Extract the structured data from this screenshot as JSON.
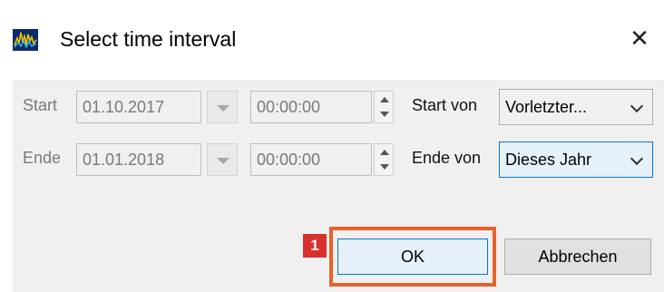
{
  "window": {
    "title": "Select time interval",
    "close_glyph": "✕",
    "app_icon": "waveform-app-icon"
  },
  "start_row": {
    "label": "Start",
    "date": "01.10.2017",
    "time": "00:00:00",
    "from_label": "Start von",
    "from_value": "Vorletzter..."
  },
  "end_row": {
    "label": "Ende",
    "date": "01.01.2018",
    "time": "00:00:00",
    "from_label": "Ende von",
    "from_value": "Dieses Jahr"
  },
  "buttons": {
    "ok": "OK",
    "cancel": "Abbrechen"
  },
  "annotation": {
    "badge": "1",
    "highlight_color": "#e8622c",
    "badge_color": "#d9302c"
  },
  "colors": {
    "focus_border": "#0078d7",
    "focus_fill": "#e5f1fb",
    "dialog_bg": "#f0f0f0"
  }
}
